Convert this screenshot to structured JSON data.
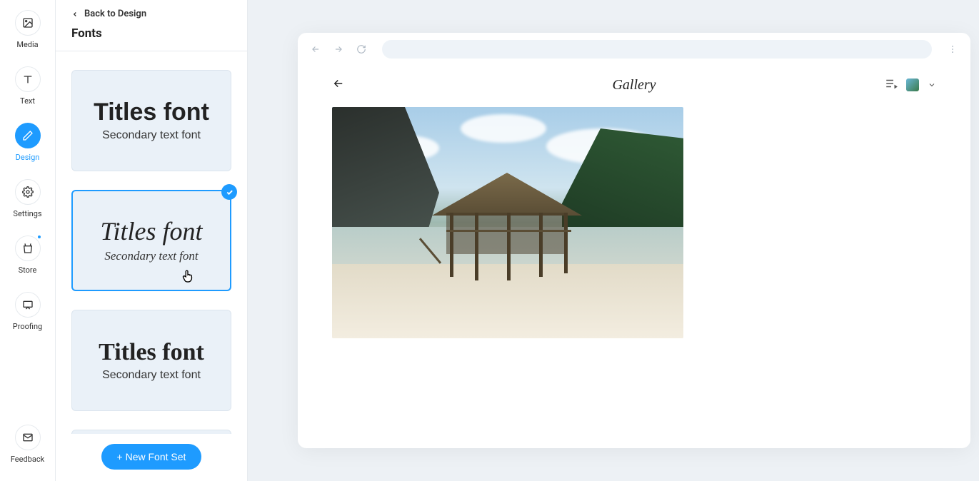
{
  "rail": {
    "media": "Media",
    "text": "Text",
    "design": "Design",
    "settings": "Settings",
    "store": "Store",
    "proofing": "Proofing",
    "feedback": "Feedback"
  },
  "panel": {
    "back_label": "Back to Design",
    "title": "Fonts",
    "new_font_btn": "+ New Font Set"
  },
  "font_cards": [
    {
      "title": "Titles font",
      "sub": "Secondary text font",
      "selected": false
    },
    {
      "title": "Titles font",
      "sub": "Secondary text font",
      "selected": true
    },
    {
      "title": "Titles font",
      "sub": "Secondary text font",
      "selected": false
    }
  ],
  "preview": {
    "page_title": "Gallery"
  },
  "colors": {
    "accent": "#1e9bff"
  }
}
